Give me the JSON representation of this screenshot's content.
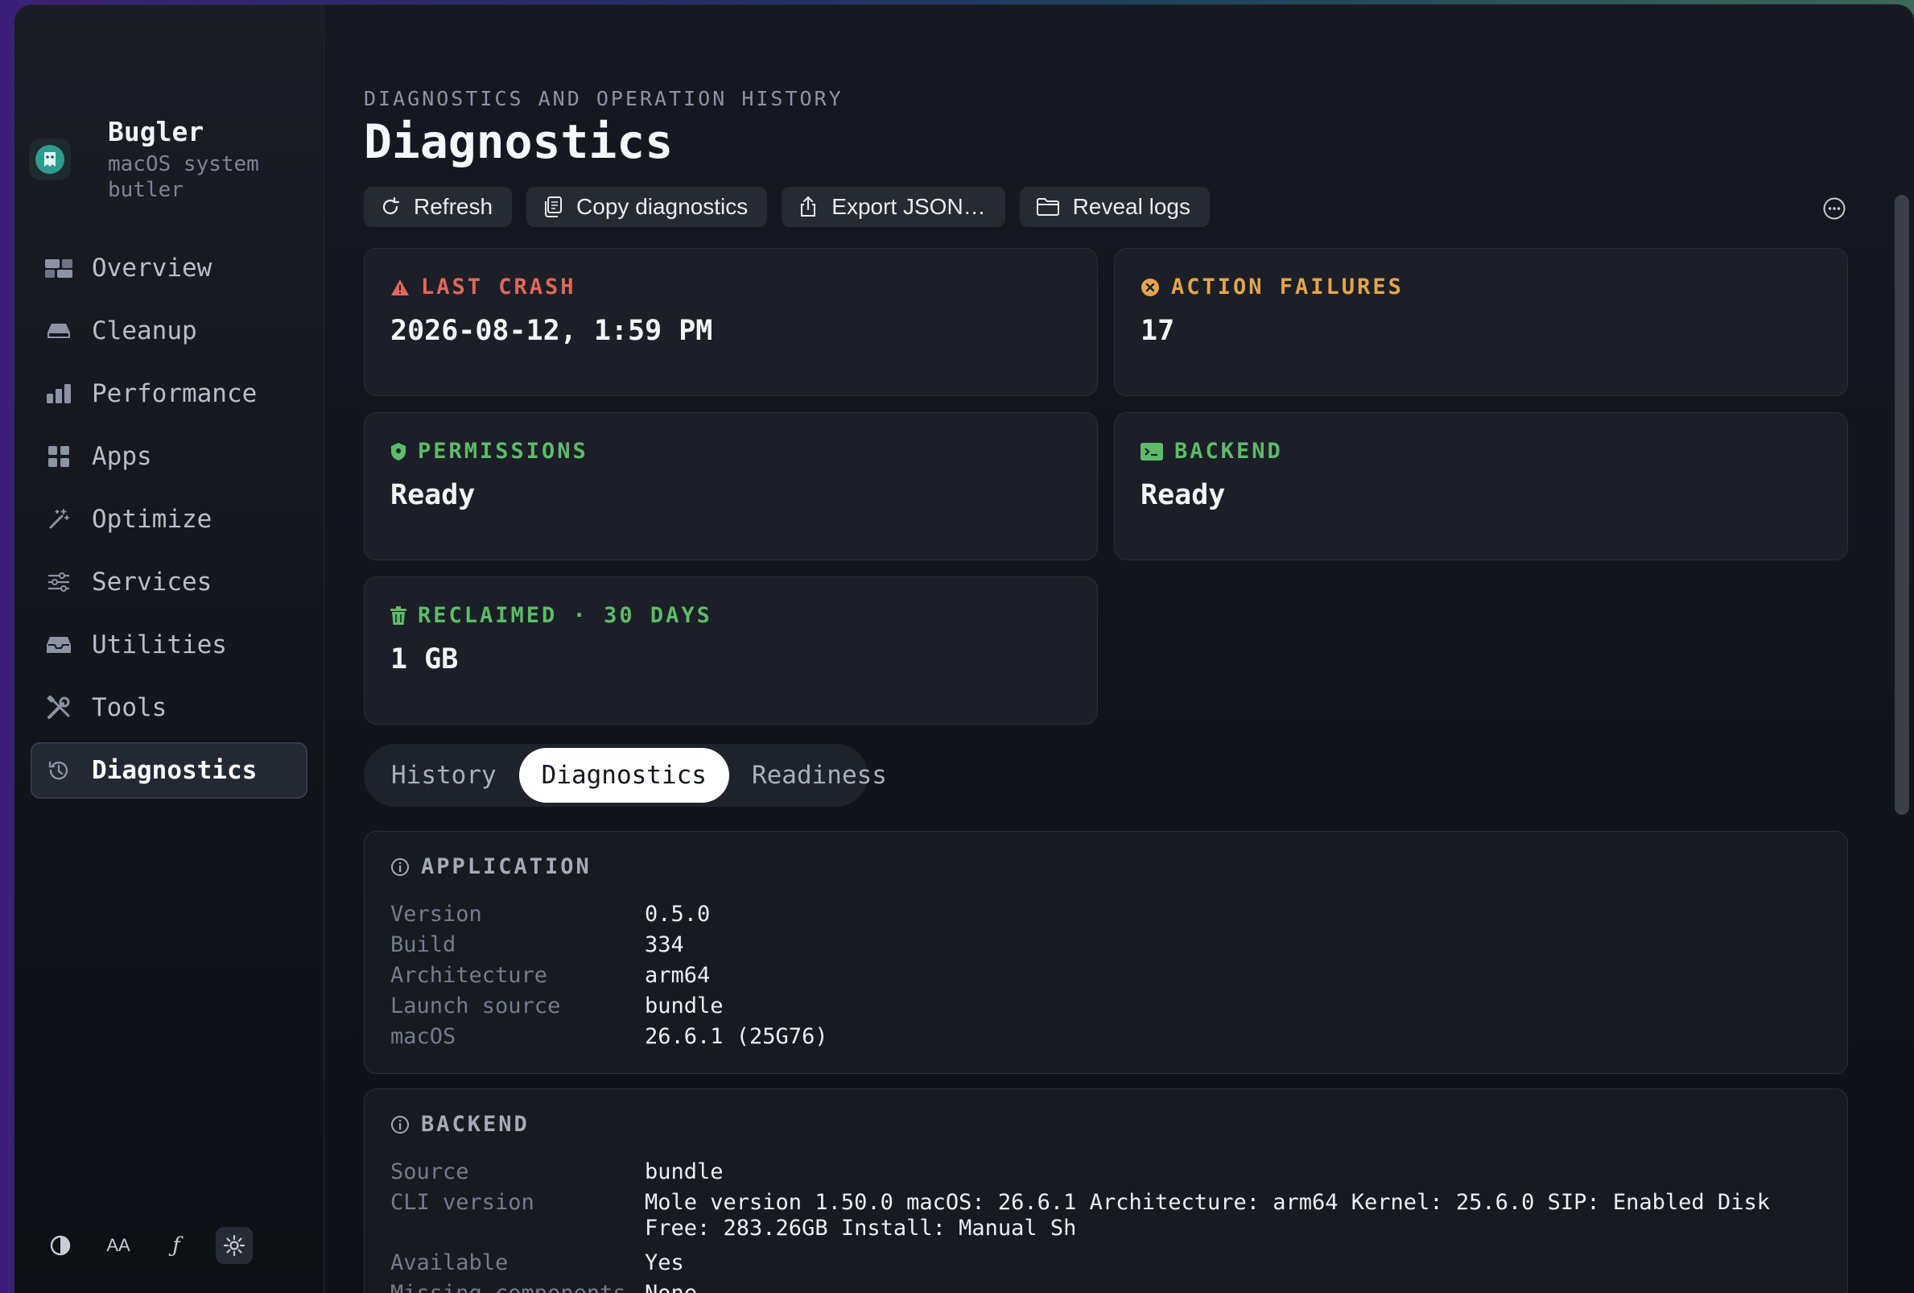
{
  "app": {
    "name": "Bugler",
    "subtitle": "macOS system butler"
  },
  "sidebar": {
    "items": [
      {
        "label": "Overview",
        "icon": "overview-icon"
      },
      {
        "label": "Cleanup",
        "icon": "disk-icon"
      },
      {
        "label": "Performance",
        "icon": "bar-chart-icon"
      },
      {
        "label": "Apps",
        "icon": "grid-icon"
      },
      {
        "label": "Optimize",
        "icon": "magic-wand-icon"
      },
      {
        "label": "Services",
        "icon": "sliders-icon"
      },
      {
        "label": "Utilities",
        "icon": "tray-icon"
      },
      {
        "label": "Tools",
        "icon": "tools-icon"
      },
      {
        "label": "Diagnostics",
        "icon": "history-icon",
        "active": true
      }
    ],
    "footer": {
      "font_size_label": "AA",
      "script_label": "ƒ"
    }
  },
  "header": {
    "eyebrow": "DIAGNOSTICS AND OPERATION HISTORY",
    "title": "Diagnostics"
  },
  "toolbar": {
    "refresh": "Refresh",
    "copy": "Copy diagnostics",
    "export": "Export JSON…",
    "reveal": "Reveal logs"
  },
  "cards": {
    "last_crash": {
      "label": "LAST CRASH",
      "value": "2026-08-12, 1:59 PM",
      "color": "#e0685a"
    },
    "action_failures": {
      "label": "ACTION FAILURES",
      "value": "17",
      "color": "#e3a64a"
    },
    "permissions": {
      "label": "PERMISSIONS",
      "value": "Ready",
      "color": "#5dbb6a"
    },
    "backend": {
      "label": "BACKEND",
      "value": "Ready",
      "color": "#5dbb6a"
    },
    "reclaimed": {
      "label": "RECLAIMED · 30 DAYS",
      "value": "1 GB",
      "color": "#5dbb6a"
    }
  },
  "tabs": {
    "history": "History",
    "diagnostics": "Diagnostics",
    "readiness": "Readiness",
    "active": "Diagnostics"
  },
  "application": {
    "title": "APPLICATION",
    "rows": [
      {
        "key": "Version",
        "value": "0.5.0"
      },
      {
        "key": "Build",
        "value": "334"
      },
      {
        "key": "Architecture",
        "value": "arm64"
      },
      {
        "key": "Launch source",
        "value": "bundle"
      },
      {
        "key": "macOS",
        "value": "26.6.1 (25G76)"
      }
    ]
  },
  "backend_panel": {
    "title": "BACKEND",
    "rows": [
      {
        "key": "Source",
        "value": "bundle"
      },
      {
        "key": "CLI version",
        "value": "Mole version 1.50.0 macOS: 26.6.1 Architecture: arm64 Kernel: 25.6.0 SIP: Enabled Disk Free: 283.26GB Install: Manual Sh"
      },
      {
        "key": "Available",
        "value": "Yes"
      },
      {
        "key": "Missing components",
        "value": "None"
      }
    ]
  }
}
